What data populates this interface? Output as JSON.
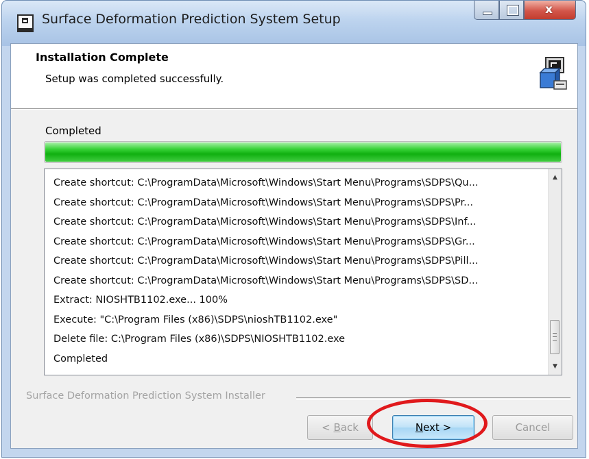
{
  "window": {
    "title": "Surface Deformation Prediction System Setup",
    "controls": {
      "minimize_icon": "minimize-icon",
      "maximize_icon": "maximize-icon",
      "close_icon": "close-icon",
      "close_glyph": "x"
    }
  },
  "header": {
    "title": "Installation Complete",
    "subtitle": "Setup was completed successfully.",
    "icon": "setup-computer-icon"
  },
  "progress": {
    "label": "Completed",
    "value_percent": 100,
    "color": "#22c022"
  },
  "log": {
    "lines": [
      "Create shortcut: C:\\ProgramData\\Microsoft\\Windows\\Start Menu\\Programs\\SDPS\\Qu...",
      "Create shortcut: C:\\ProgramData\\Microsoft\\Windows\\Start Menu\\Programs\\SDPS\\Pr...",
      "Create shortcut: C:\\ProgramData\\Microsoft\\Windows\\Start Menu\\Programs\\SDPS\\Inf...",
      "Create shortcut: C:\\ProgramData\\Microsoft\\Windows\\Start Menu\\Programs\\SDPS\\Gr...",
      "Create shortcut: C:\\ProgramData\\Microsoft\\Windows\\Start Menu\\Programs\\SDPS\\Pill...",
      "Create shortcut: C:\\ProgramData\\Microsoft\\Windows\\Start Menu\\Programs\\SDPS\\SD...",
      "Extract: NIOSHTB1102.exe... 100%",
      "Execute: \"C:\\Program Files (x86)\\SDPS\\nioshTB1102.exe\"",
      "Delete file: C:\\Program Files (x86)\\SDPS\\NIOSHTB1102.exe",
      "Completed"
    ]
  },
  "footer": {
    "branding": "Surface Deformation Prediction System Installer",
    "buttons": {
      "back": {
        "prefix": "< ",
        "mnemonic": "B",
        "rest": "ack",
        "enabled": false
      },
      "next": {
        "mnemonic": "N",
        "rest": "ext >",
        "enabled": true
      },
      "cancel": {
        "label": "Cancel",
        "enabled": false
      }
    }
  },
  "annotation": {
    "highlight_color": "#e0191c",
    "highlight_target": "next-button"
  }
}
